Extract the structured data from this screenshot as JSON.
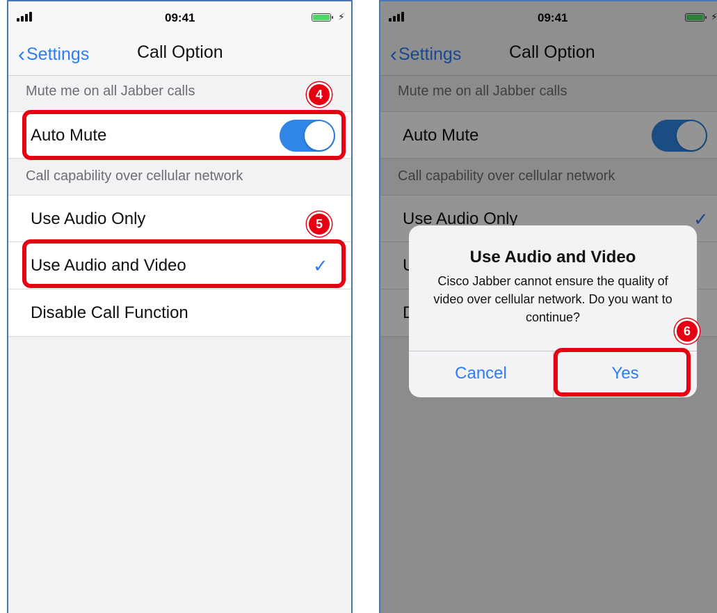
{
  "status_bar": {
    "time": "09:41"
  },
  "nav": {
    "back_label": "Settings",
    "title": "Call Option"
  },
  "sections": {
    "mute_header": "Mute me on all Jabber calls",
    "auto_mute_label": "Auto Mute",
    "auto_mute_on": true,
    "cellular_header": "Call capability over cellular network",
    "options": [
      "Use Audio Only",
      "Use Audio and Video",
      "Disable Call Function"
    ]
  },
  "left_panel": {
    "selected_option": "Use Audio and Video"
  },
  "right_panel": {
    "selected_option": "Use Audio Only",
    "partial_option_1": "U",
    "partial_option_2": "D"
  },
  "alert": {
    "title": "Use Audio and Video",
    "message": "Cisco Jabber cannot ensure the quality of video over cellular network. Do you want to continue?",
    "cancel_label": "Cancel",
    "yes_label": "Yes"
  },
  "annotations": {
    "step_4": "4",
    "step_5": "5",
    "step_6": "6"
  },
  "colors": {
    "accent": "#2e7cf6",
    "toggle_on": "#2f86e6",
    "highlight": "#e60012",
    "battery": "#4cd964"
  }
}
